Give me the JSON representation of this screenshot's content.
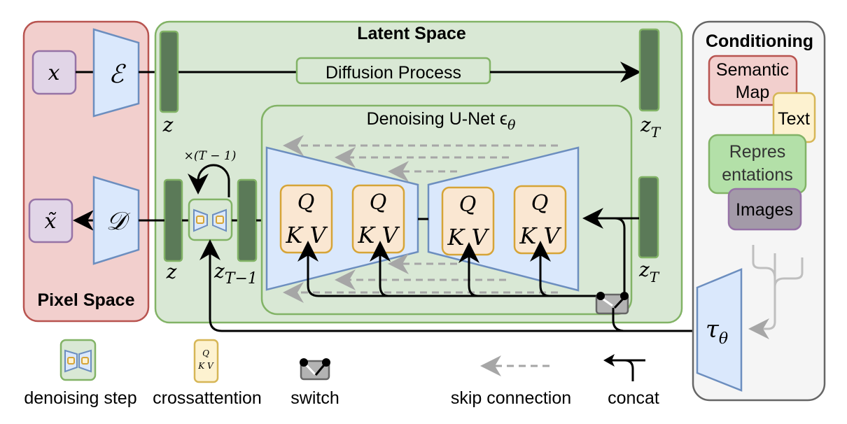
{
  "regions": {
    "pixel_space": {
      "title": "Pixel Space",
      "fill": "#f2cfcd",
      "stroke": "#b85450"
    },
    "latent_space": {
      "title": "Latent Space",
      "fill": "#d9e8d5",
      "stroke": "#82b366"
    },
    "conditioning": {
      "title": "Conditioning",
      "fill": "#f5f5f5",
      "stroke": "#666666"
    }
  },
  "pixel": {
    "input_label": "x",
    "output_label": "x̃",
    "encoder_label": "ℰ",
    "decoder_label": "𝒟"
  },
  "latent": {
    "z_top_label": "z",
    "z_bottom_label": "z",
    "zT_top_label": "z",
    "zT_top_sub": "T",
    "zT_bottom_label": "z",
    "zT_bottom_sub": "T",
    "z_T_minus_1_label": "z",
    "z_T_minus_1_sub": "T−1",
    "diffusion_process_label": "Diffusion Process",
    "repeat_label": "×(T − 1)",
    "unet_title": "Denoising U-Net ϵ",
    "unet_title_sub": "θ"
  },
  "crossattention_blocks": [
    {
      "q": "Q",
      "kv": "K V"
    },
    {
      "q": "Q",
      "kv": "K V"
    },
    {
      "q": "Q",
      "kv": "K V"
    },
    {
      "q": "Q",
      "kv": "K V"
    }
  ],
  "conditioning_items": [
    {
      "label_lines": [
        "Semantic",
        "Map"
      ],
      "fill": "#f2cfcd",
      "stroke": "#b85450"
    },
    {
      "label_lines": [
        "Text"
      ],
      "fill": "#fdf2d0",
      "stroke": "#d6b656"
    },
    {
      "label_lines": [
        "Repres",
        "entations"
      ],
      "fill": "#b3e0a8",
      "stroke": "#82b366"
    },
    {
      "label_lines": [
        "Images"
      ],
      "fill": "#a39aa8",
      "stroke": "#9673a6"
    }
  ],
  "tau": {
    "label": "τ",
    "sub": "θ"
  },
  "legend": [
    {
      "icon": "denoising-step-icon",
      "label": "denoising step"
    },
    {
      "icon": "crossattention-icon",
      "label": "crossattention",
      "q": "Q",
      "kv": "K V"
    },
    {
      "icon": "switch-icon",
      "label": "switch"
    },
    {
      "icon": "skip-connection-icon",
      "label": "skip connection"
    },
    {
      "icon": "concat-icon",
      "label": "concat"
    }
  ],
  "colors": {
    "latent_bar": "#5b7a58",
    "latent_bar_stroke": "#82b366",
    "trapezoid_fill": "#dae8fc",
    "trapezoid_stroke": "#6c8ebf",
    "qkv_fill": "#fae7d2",
    "qkv_stroke": "#d6a437",
    "xbox_fill": "#e1d5e7",
    "xbox_stroke": "#9673a6",
    "skip": "#a6a6a6",
    "switch_fill": "#b3b3b3",
    "switch_stroke": "#666666"
  }
}
